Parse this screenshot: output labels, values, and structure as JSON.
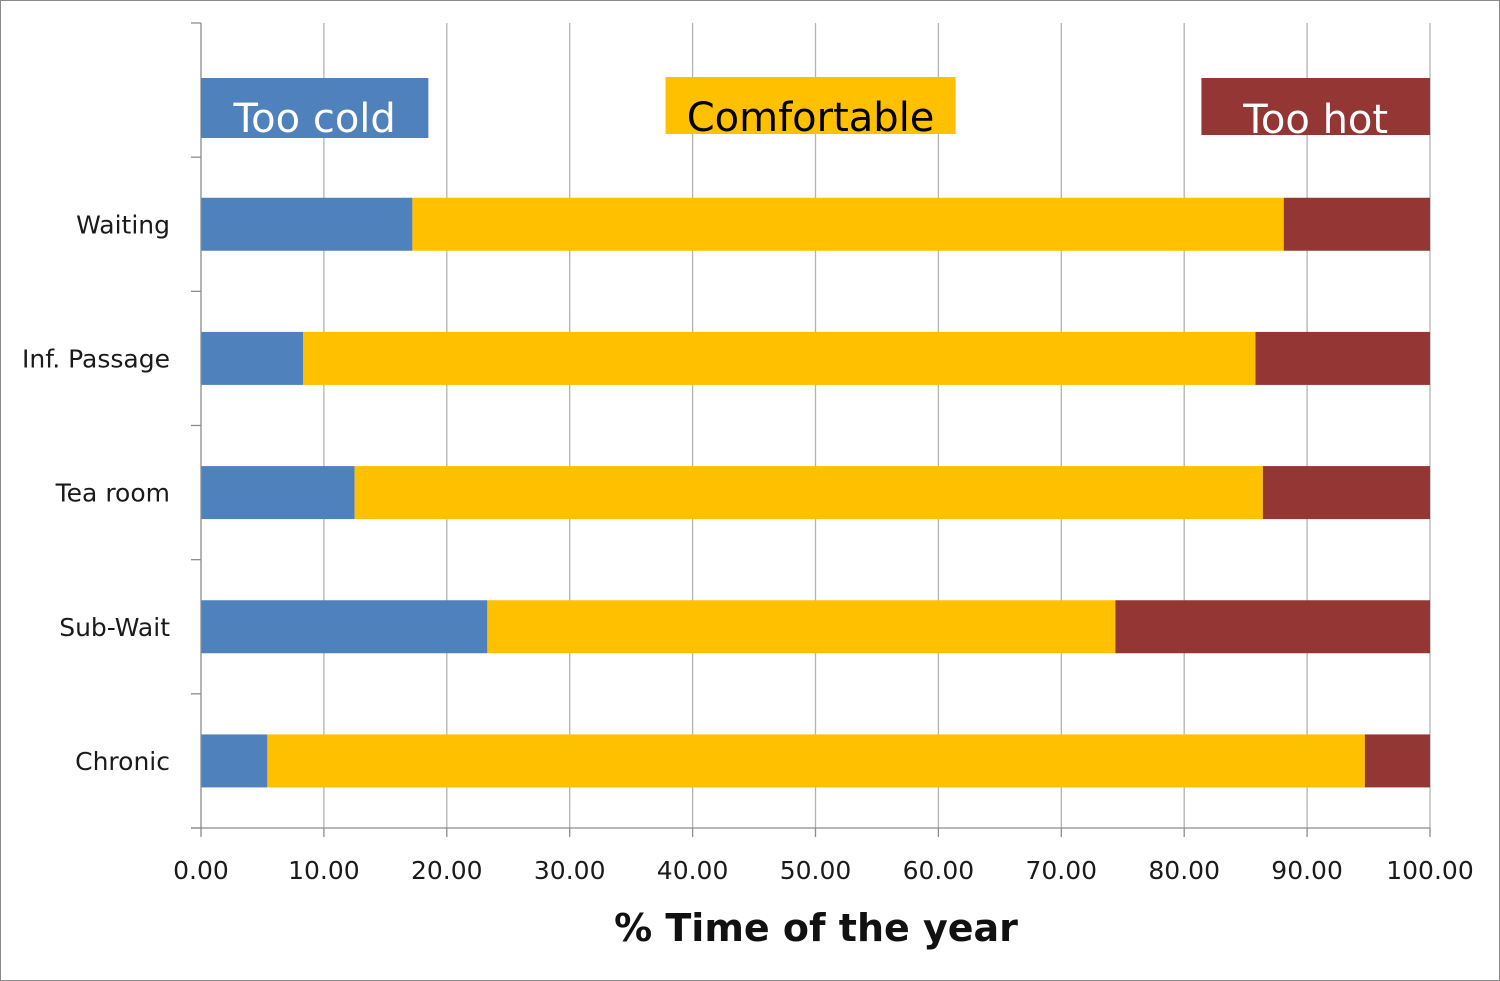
{
  "chart_data": {
    "type": "bar",
    "orientation": "horizontal",
    "stacked": true,
    "title": "",
    "xlabel": "% Time of the year",
    "ylabel": "",
    "xlim": [
      0,
      100
    ],
    "x_ticks": [
      0,
      10,
      20,
      30,
      40,
      50,
      60,
      70,
      80,
      90,
      100
    ],
    "x_tick_labels": [
      "0.00",
      "10.00",
      "20.00",
      "30.00",
      "40.00",
      "50.00",
      "60.00",
      "70.00",
      "80.00",
      "90.00",
      "100.00"
    ],
    "grid": "vertical",
    "categories": [
      "Waiting",
      "Inf. Passage",
      "Tea room",
      "Sub-Wait",
      "Chronic"
    ],
    "series": [
      {
        "name": "Too cold",
        "color": "#4f81bd",
        "text_color": "#ffffff",
        "values": [
          17.2,
          8.3,
          12.5,
          23.3,
          5.4
        ]
      },
      {
        "name": "Comfortable",
        "color": "#ffc000",
        "text_color": "#000000",
        "values": [
          70.9,
          77.5,
          73.9,
          51.1,
          89.3
        ]
      },
      {
        "name": "Too hot",
        "color": "#943634",
        "text_color": "#ffffff",
        "values": [
          11.9,
          14.2,
          13.6,
          25.6,
          5.3
        ]
      }
    ],
    "legend": {
      "placement": "top",
      "style": "labeled boxes in empty top category row",
      "items": [
        "Too cold",
        "Comfortable",
        "Too hot"
      ]
    }
  }
}
